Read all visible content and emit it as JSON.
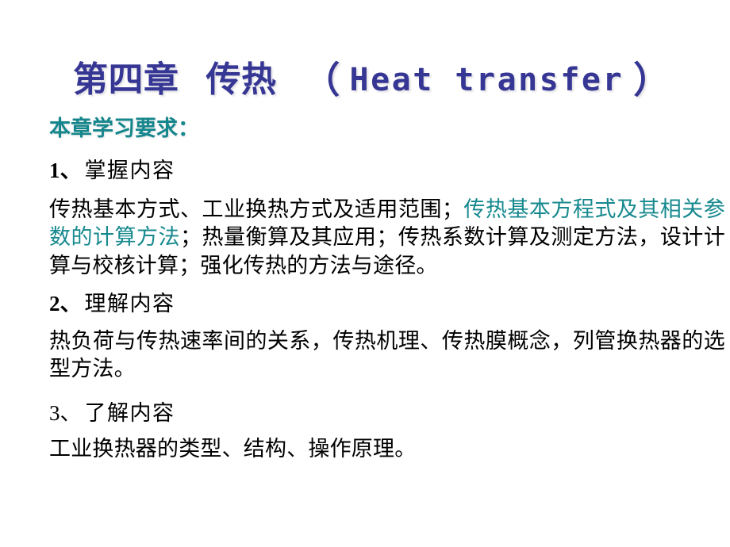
{
  "slide": {
    "background_color": "#ffffff",
    "title": {
      "chapter": "第四章",
      "topic": "传热",
      "paren_open": "（",
      "english": "Heat transfer",
      "paren_close": "）",
      "color": "#363694"
    },
    "requirements_heading": {
      "text": "本章学习要求：",
      "color": "#15868c"
    },
    "sections": [
      {
        "number": "1",
        "separator": "、",
        "label": "掌握内容",
        "body_segments": [
          {
            "text": "传热基本方式、工业换热方式及适用范围；",
            "color": "#000000",
            "highlight": false
          },
          {
            "text": "传热基本方程式及其相关参数的计算方法",
            "color": "#16898e",
            "highlight": true
          },
          {
            "text": "；热量衡算及其应用；传热系数计算及测定方法，设计计算与校核计算；强化传热的方法与途径。",
            "color": "#000000",
            "highlight": false
          }
        ]
      },
      {
        "number": "2",
        "separator": "、",
        "label": "理解内容",
        "body_segments": [
          {
            "text": "热负荷与传热速率间的关系，传热机理、传热膜概念，列管换热器的选型方法。",
            "color": "#000000",
            "highlight": false
          }
        ]
      },
      {
        "number": "3",
        "separator": "、",
        "label": "了解内容",
        "body_segments": [
          {
            "text": "工业换热器的类型、结构、操作原理。",
            "color": "#000000",
            "highlight": false
          }
        ]
      }
    ]
  }
}
